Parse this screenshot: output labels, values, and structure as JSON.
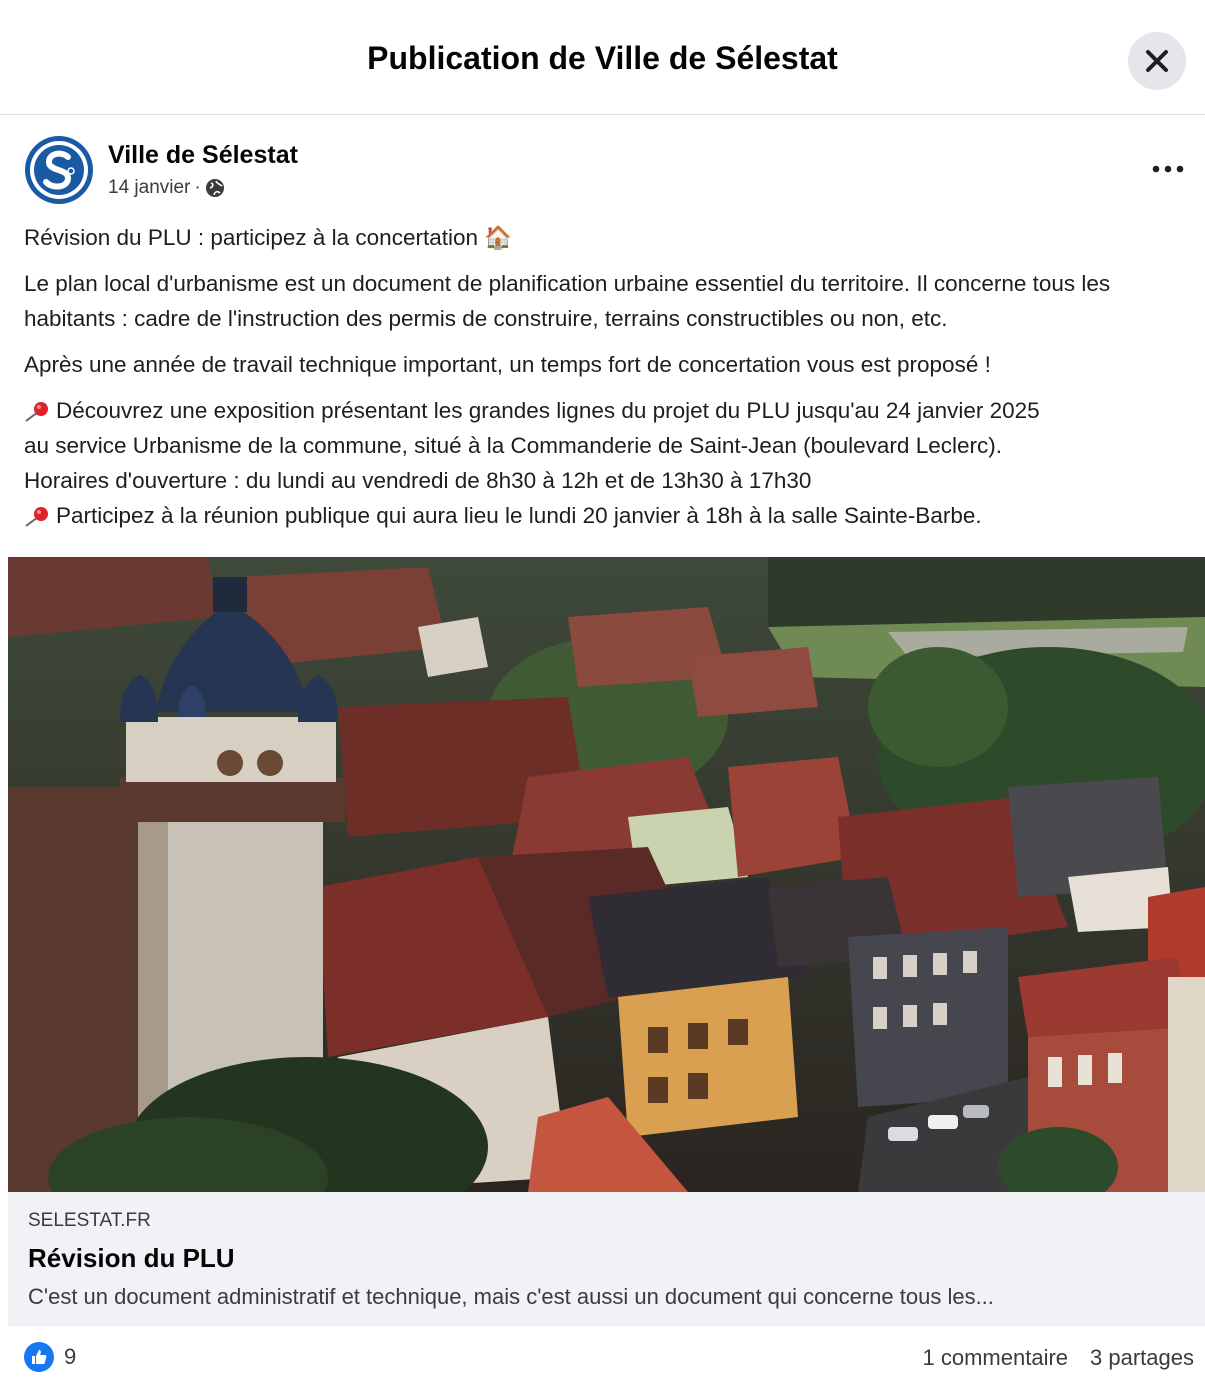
{
  "dialog": {
    "title": "Publication de Ville de Sélestat"
  },
  "post": {
    "author": "Ville de Sélestat",
    "date": "14 janvier",
    "separator": "·",
    "heading": "Révision du PLU : participez à la concertation",
    "heading_emoji": "🏠",
    "paragraph1": "Le plan local d'urbanisme est un document de planification urbaine essentiel du territoire. Il concerne tous les habitants : cadre de l'instruction des permis de construire, terrains constructibles ou non, etc.",
    "paragraph2": "Après une année de travail technique important, un temps fort de concertation vous est proposé !",
    "bullet1_line1": "Découvrez une exposition présentant les grandes lignes du projet du PLU jusqu'au 24 janvier 2025",
    "bullet1_line2": "au service Urbanisme de la commune, situé à la Commanderie de Saint-Jean (boulevard Leclerc).",
    "bullet1_line3": "Horaires d'ouverture : du lundi au vendredi de 8h30 à 12h et de 13h30 à 17h30",
    "bullet2": "Participez à la réunion publique qui aura lieu le lundi 20 janvier à 18h à la salle Sainte-Barbe."
  },
  "link_preview": {
    "domain": "SELESTAT.FR",
    "title": "Révision du PLU",
    "description": "C'est un document administratif et technique, mais c'est aussi un document qui concerne tous les..."
  },
  "stats": {
    "likes": "9",
    "comments": "1 commentaire",
    "shares": "3 partages"
  },
  "colors": {
    "accent": "#1877f2",
    "link_bg": "#f0f2f5"
  }
}
